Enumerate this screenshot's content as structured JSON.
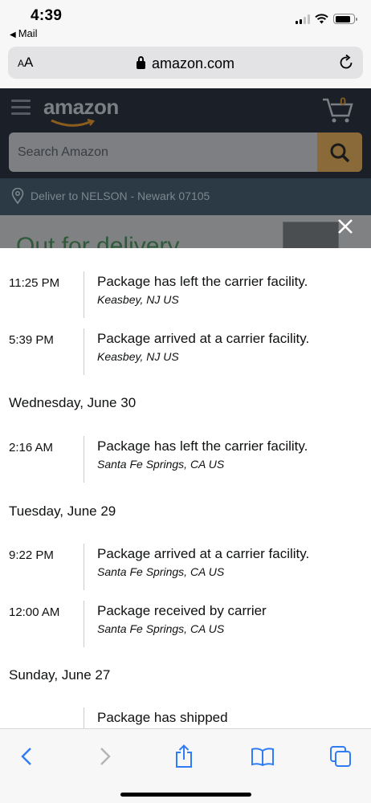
{
  "status_bar": {
    "time": "4:39",
    "back_app": "Mail"
  },
  "browser": {
    "text_size_label": "AA",
    "domain": "amazon.com"
  },
  "amazon": {
    "cart_count": "0",
    "search_placeholder": "Search Amazon",
    "deliver_to": "Deliver to NELSON - Newark 07105",
    "behind_title": "Out for delivery"
  },
  "tracking": {
    "rows": [
      {
        "time": "11:25 PM",
        "description": "Package has left the carrier facility.",
        "location": "Keasbey, NJ US"
      },
      {
        "time": "5:39 PM",
        "description": "Package arrived at a carrier facility.",
        "location": "Keasbey, NJ US"
      },
      {
        "heading": "Wednesday, June 30"
      },
      {
        "time": "2:16 AM",
        "description": "Package has left the carrier facility.",
        "location": "Santa Fe Springs, CA US"
      },
      {
        "heading": "Tuesday, June 29"
      },
      {
        "time": "9:22 PM",
        "description": "Package arrived at a carrier facility.",
        "location": "Santa Fe Springs, CA US"
      },
      {
        "time": "12:00 AM",
        "description": "Package received by carrier",
        "location": "Santa Fe Springs, CA US"
      },
      {
        "heading": "Sunday, June 27"
      },
      {
        "time": "",
        "description": "Package has shipped",
        "location": ""
      }
    ]
  },
  "colors": {
    "ios_blue": "#2f7cf6",
    "amazon_dark": "#1b2028",
    "text": "#0f1111"
  }
}
